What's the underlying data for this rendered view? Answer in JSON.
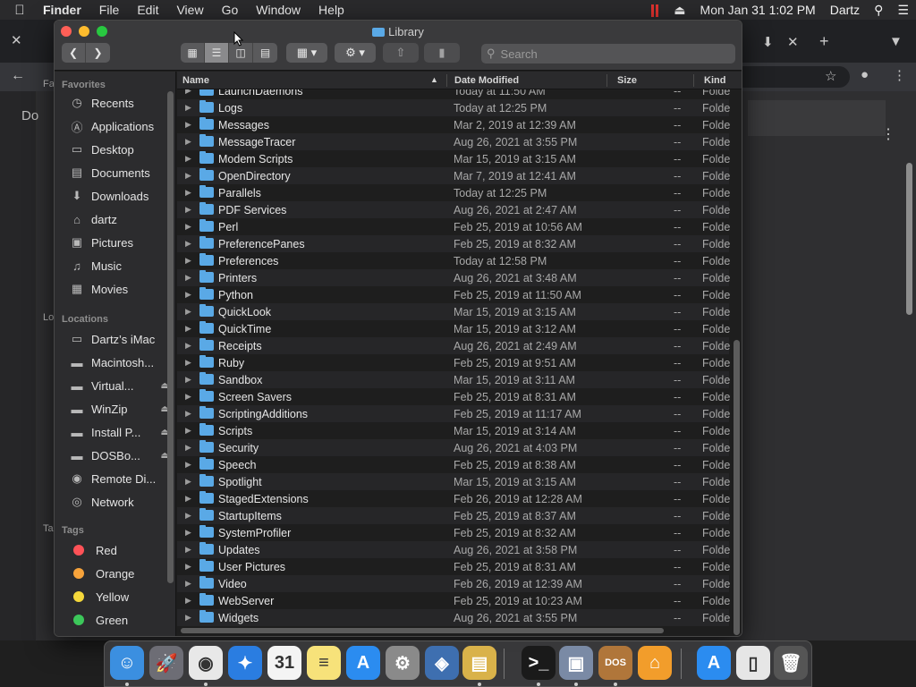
{
  "menubar": {
    "app": "Finder",
    "menus": [
      "File",
      "Edit",
      "View",
      "Go",
      "Window",
      "Help"
    ],
    "datetime": "Mon Jan 31  1:02 PM",
    "user": "Dartz"
  },
  "browser": {
    "left_texts": [
      "Fa",
      "Do",
      "Lo",
      "Ta"
    ]
  },
  "window": {
    "title": "Library"
  },
  "search": {
    "placeholder": "Search"
  },
  "sidebar": {
    "favorites_header": "Favorites",
    "favorites": [
      {
        "label": "Recents",
        "icon": "clock-icon"
      },
      {
        "label": "Applications",
        "icon": "applications-icon"
      },
      {
        "label": "Desktop",
        "icon": "desktop-icon"
      },
      {
        "label": "Documents",
        "icon": "document-icon"
      },
      {
        "label": "Downloads",
        "icon": "download-icon"
      },
      {
        "label": "dartz",
        "icon": "home-icon"
      },
      {
        "label": "Pictures",
        "icon": "camera-icon"
      },
      {
        "label": "Music",
        "icon": "music-icon"
      },
      {
        "label": "Movies",
        "icon": "film-icon"
      }
    ],
    "locations_header": "Locations",
    "locations": [
      {
        "label": "Dartz’s iMac",
        "icon": "computer-icon",
        "eject": false
      },
      {
        "label": "Macintosh...",
        "icon": "disk-icon",
        "eject": false
      },
      {
        "label": "Virtual...",
        "icon": "disk-icon",
        "eject": true
      },
      {
        "label": "WinZip",
        "icon": "disk-icon",
        "eject": true
      },
      {
        "label": "Install P...",
        "icon": "disk-icon",
        "eject": true
      },
      {
        "label": "DOSBo...",
        "icon": "disk-icon",
        "eject": true
      },
      {
        "label": "Remote Di...",
        "icon": "disc-icon",
        "eject": false
      },
      {
        "label": "Network",
        "icon": "globe-icon",
        "eject": false
      }
    ],
    "tags_header": "Tags",
    "tags": [
      {
        "label": "Red",
        "color": "#ff5257"
      },
      {
        "label": "Orange",
        "color": "#f7a33b"
      },
      {
        "label": "Yellow",
        "color": "#f5d83b"
      },
      {
        "label": "Green",
        "color": "#3cc75a"
      }
    ]
  },
  "columns": {
    "name": "Name",
    "date": "Date Modified",
    "size": "Size",
    "kind": "Kind"
  },
  "files": [
    {
      "name": "LaunchDaemons",
      "date": "Today at 11:50 AM",
      "size": "--",
      "kind": "Folde"
    },
    {
      "name": "Logs",
      "date": "Today at 12:25 PM",
      "size": "--",
      "kind": "Folde"
    },
    {
      "name": "Messages",
      "date": "Mar 2, 2019 at 12:39 AM",
      "size": "--",
      "kind": "Folde"
    },
    {
      "name": "MessageTracer",
      "date": "Aug 26, 2021 at 3:55 PM",
      "size": "--",
      "kind": "Folde"
    },
    {
      "name": "Modem Scripts",
      "date": "Mar 15, 2019 at 3:15 AM",
      "size": "--",
      "kind": "Folde"
    },
    {
      "name": "OpenDirectory",
      "date": "Mar 7, 2019 at 12:41 AM",
      "size": "--",
      "kind": "Folde"
    },
    {
      "name": "Parallels",
      "date": "Today at 12:25 PM",
      "size": "--",
      "kind": "Folde"
    },
    {
      "name": "PDF Services",
      "date": "Aug 26, 2021 at 2:47 AM",
      "size": "--",
      "kind": "Folde"
    },
    {
      "name": "Perl",
      "date": "Feb 25, 2019 at 10:56 AM",
      "size": "--",
      "kind": "Folde"
    },
    {
      "name": "PreferencePanes",
      "date": "Feb 25, 2019 at 8:32 AM",
      "size": "--",
      "kind": "Folde"
    },
    {
      "name": "Preferences",
      "date": "Today at 12:58 PM",
      "size": "--",
      "kind": "Folde"
    },
    {
      "name": "Printers",
      "date": "Aug 26, 2021 at 3:48 AM",
      "size": "--",
      "kind": "Folde"
    },
    {
      "name": "Python",
      "date": "Feb 25, 2019 at 11:50 AM",
      "size": "--",
      "kind": "Folde"
    },
    {
      "name": "QuickLook",
      "date": "Mar 15, 2019 at 3:15 AM",
      "size": "--",
      "kind": "Folde"
    },
    {
      "name": "QuickTime",
      "date": "Mar 15, 2019 at 3:12 AM",
      "size": "--",
      "kind": "Folde"
    },
    {
      "name": "Receipts",
      "date": "Aug 26, 2021 at 2:49 AM",
      "size": "--",
      "kind": "Folde"
    },
    {
      "name": "Ruby",
      "date": "Feb 25, 2019 at 9:51 AM",
      "size": "--",
      "kind": "Folde"
    },
    {
      "name": "Sandbox",
      "date": "Mar 15, 2019 at 3:11 AM",
      "size": "--",
      "kind": "Folde"
    },
    {
      "name": "Screen Savers",
      "date": "Feb 25, 2019 at 8:31 AM",
      "size": "--",
      "kind": "Folde"
    },
    {
      "name": "ScriptingAdditions",
      "date": "Feb 25, 2019 at 11:17 AM",
      "size": "--",
      "kind": "Folde"
    },
    {
      "name": "Scripts",
      "date": "Mar 15, 2019 at 3:14 AM",
      "size": "--",
      "kind": "Folde"
    },
    {
      "name": "Security",
      "date": "Aug 26, 2021 at 4:03 PM",
      "size": "--",
      "kind": "Folde"
    },
    {
      "name": "Speech",
      "date": "Feb 25, 2019 at 8:38 AM",
      "size": "--",
      "kind": "Folde"
    },
    {
      "name": "Spotlight",
      "date": "Mar 15, 2019 at 3:15 AM",
      "size": "--",
      "kind": "Folde"
    },
    {
      "name": "StagedExtensions",
      "date": "Feb 26, 2019 at 12:28 AM",
      "size": "--",
      "kind": "Folde"
    },
    {
      "name": "StartupItems",
      "date": "Feb 25, 2019 at 8:37 AM",
      "size": "--",
      "kind": "Folde"
    },
    {
      "name": "SystemProfiler",
      "date": "Feb 25, 2019 at 8:32 AM",
      "size": "--",
      "kind": "Folde"
    },
    {
      "name": "Updates",
      "date": "Aug 26, 2021 at 3:58 PM",
      "size": "--",
      "kind": "Folde"
    },
    {
      "name": "User Pictures",
      "date": "Feb 25, 2019 at 8:31 AM",
      "size": "--",
      "kind": "Folde"
    },
    {
      "name": "Video",
      "date": "Feb 26, 2019 at 12:39 AM",
      "size": "--",
      "kind": "Folde"
    },
    {
      "name": "WebServer",
      "date": "Feb 25, 2019 at 10:23 AM",
      "size": "--",
      "kind": "Folde"
    },
    {
      "name": "Widgets",
      "date": "Aug 26, 2021 at 3:55 PM",
      "size": "--",
      "kind": "Folde"
    }
  ],
  "dock": {
    "items": [
      {
        "name": "finder-dock-icon",
        "color": "#3b8fe0",
        "glyph": "☺",
        "running": true
      },
      {
        "name": "launchpad-dock-icon",
        "color": "#6d6d75",
        "glyph": "🚀",
        "running": false
      },
      {
        "name": "chrome-dock-icon",
        "color": "#e8e8e8",
        "glyph": "◉",
        "running": true
      },
      {
        "name": "safari-dock-icon",
        "color": "#2a7de1",
        "glyph": "✦",
        "running": false
      },
      {
        "name": "calendar-dock-icon",
        "color": "#f4f4f4",
        "glyph": "31",
        "running": false
      },
      {
        "name": "notes-dock-icon",
        "color": "#f7e27a",
        "glyph": "≡",
        "running": false
      },
      {
        "name": "app-store-dock-icon",
        "color": "#2b8cf0",
        "glyph": "A",
        "running": false
      },
      {
        "name": "system-preferences-dock-icon",
        "color": "#8a8a8a",
        "glyph": "⚙",
        "running": false
      },
      {
        "name": "virtualbox-dock-icon",
        "color": "#3e6fb0",
        "glyph": "◈",
        "running": false
      },
      {
        "name": "archive-utility-dock-icon",
        "color": "#d9b24a",
        "glyph": "▤",
        "running": true
      },
      {
        "name": "terminal-dock-icon",
        "color": "#1a1a1a",
        "glyph": ">_",
        "running": true
      },
      {
        "name": "parallels-dock-icon",
        "color": "#7a8aa5",
        "glyph": "▣",
        "running": true
      },
      {
        "name": "dosbox-dock-icon",
        "color": "#b0763a",
        "glyph": "DOS",
        "running": true
      },
      {
        "name": "home-dock-icon",
        "color": "#f29d2b",
        "glyph": "⌂",
        "running": false
      },
      {
        "name": "app-store-2-dock-icon",
        "color": "#2b8cf0",
        "glyph": "A",
        "running": false
      },
      {
        "name": "document-dock-icon",
        "color": "#e6e6e6",
        "glyph": "▯",
        "running": false
      },
      {
        "name": "trash-dock-icon",
        "color": "#555",
        "glyph": "🗑",
        "running": false
      }
    ]
  }
}
